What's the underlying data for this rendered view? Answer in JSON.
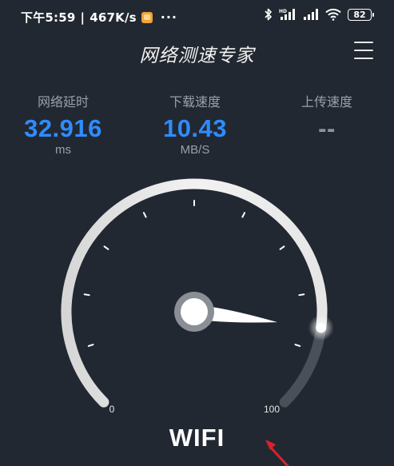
{
  "status_bar": {
    "time": "下午5:59",
    "separator": "|",
    "net_speed": "467K/s",
    "more": "···",
    "battery": "82"
  },
  "header": {
    "title": "网络测速专家"
  },
  "stats": {
    "latency": {
      "label": "网络延时",
      "value": "32.916",
      "unit": "ms"
    },
    "download": {
      "label": "下载速度",
      "value": "10.43",
      "unit": "MB/S"
    },
    "upload": {
      "label": "上传速度",
      "value": "--"
    }
  },
  "gauge": {
    "min_label": "0",
    "max_label": "100",
    "reading_fraction": 0.86,
    "connection_type": "WIFI"
  },
  "colors": {
    "background": "#222831",
    "accent_blue": "#2f8cff",
    "label_gray": "#9aa0a8",
    "annotation_red": "#d8232a"
  }
}
